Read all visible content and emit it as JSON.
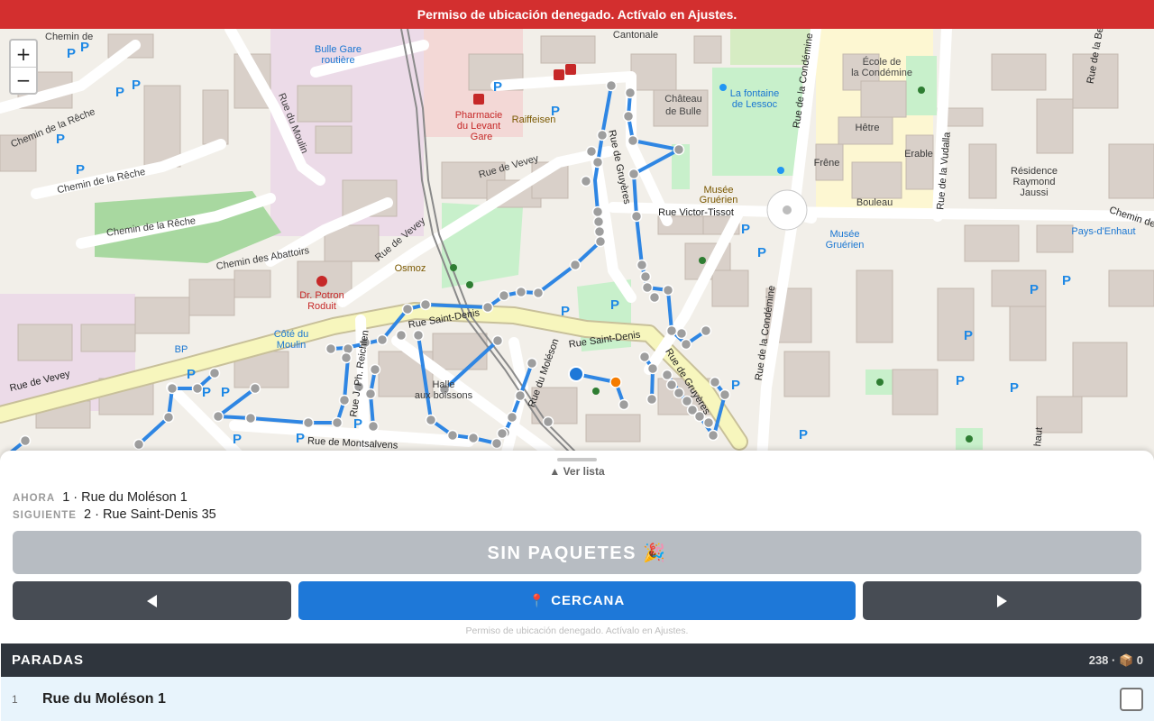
{
  "alert": {
    "text": "Permiso de ubicación denegado. Actívalo en Ajustes."
  },
  "map": {
    "zoom_in": "+",
    "zoom_out": "−",
    "labels": [
      {
        "text": "Chemin de",
        "dn": "map-label-chemin-de"
      },
      {
        "text": "Cantonale",
        "dn": "map-label-cantonale"
      },
      {
        "text": "Bulle Gare",
        "dn": "map-label-bulle-gare"
      },
      {
        "text": "routière",
        "dn": "map-label-routiere"
      },
      {
        "text": "Château",
        "dn": "map-label-chateau"
      },
      {
        "text": "de Bulle",
        "dn": "map-label-de-bulle"
      },
      {
        "text": "La fontaine",
        "dn": "map-label-fontaine"
      },
      {
        "text": "de Lessoc",
        "dn": "map-label-lessoc"
      },
      {
        "text": "École de",
        "dn": "map-label-ecole"
      },
      {
        "text": "la Condémine",
        "dn": "map-label-la-condemine"
      },
      {
        "text": "Hêtre",
        "dn": "map-label-hetre"
      },
      {
        "text": "Frêne",
        "dn": "map-label-frene"
      },
      {
        "text": "Erable",
        "dn": "map-label-erable"
      },
      {
        "text": "Bouleau",
        "dn": "map-label-bouleau"
      },
      {
        "text": "Résidence",
        "dn": "map-label-residence"
      },
      {
        "text": "Raymond",
        "dn": "map-label-raymond"
      },
      {
        "text": "Jaussi",
        "dn": "map-label-jaussi"
      },
      {
        "text": "Pharmacie",
        "dn": "map-label-pharmacie"
      },
      {
        "text": "du Levant",
        "dn": "map-label-du-levant"
      },
      {
        "text": "Gare",
        "dn": "map-label-gare"
      },
      {
        "text": "Raiffeisen",
        "dn": "map-label-raiffeisen"
      },
      {
        "text": "Rue de Vevey",
        "dn": "map-label-rue-vevey-north"
      },
      {
        "text": "Musée",
        "dn": "map-label-musee"
      },
      {
        "text": "Gruérien",
        "dn": "map-label-gruerien"
      },
      {
        "text": "Rue Victor-Tissot",
        "dn": "map-label-victor-tissot"
      },
      {
        "text": "Musée",
        "dn": "map-label-musee-2"
      },
      {
        "text": "Gruérien",
        "dn": "map-label-gruerien-2"
      },
      {
        "text": "Pays-d'Enhaut",
        "dn": "map-label-pays-enhaut"
      },
      {
        "text": "Chemin de la Rêche",
        "dn": "map-label-reche-1"
      },
      {
        "text": "Chemin de la Rêche",
        "dn": "map-label-reche-2"
      },
      {
        "text": "Chemin de la Rêche",
        "dn": "map-label-reche-3"
      },
      {
        "text": "Chemin des Abattoirs",
        "dn": "map-label-abattoirs"
      },
      {
        "text": "Rue du Moulin",
        "dn": "map-label-moulin"
      },
      {
        "text": "Rue de Vevey",
        "dn": "map-label-rue-vevey-mid"
      },
      {
        "text": "Osmoz",
        "dn": "map-label-osmoz"
      },
      {
        "text": "Dr. Potron",
        "dn": "map-label-dr-potron"
      },
      {
        "text": "Roduit",
        "dn": "map-label-roduit"
      },
      {
        "text": "Côté du",
        "dn": "map-label-cote-du"
      },
      {
        "text": "Moulin",
        "dn": "map-label-moulin-2"
      },
      {
        "text": "BP",
        "dn": "map-label-bp"
      },
      {
        "text": "Rue Saint-Denis",
        "dn": "map-label-saint-denis-1"
      },
      {
        "text": "Rue Saint-Denis",
        "dn": "map-label-saint-denis-2"
      },
      {
        "text": "Rue du Moléson",
        "dn": "map-label-moleson"
      },
      {
        "text": "Rue de Gruyères",
        "dn": "map-label-gruyeres-south"
      },
      {
        "text": "Rue de Gruyères",
        "dn": "map-label-gruyeres-north"
      },
      {
        "text": "Rue de la Condémine",
        "dn": "map-label-condemine-south"
      },
      {
        "text": "Rue de la Condémine",
        "dn": "map-label-condemine-north"
      },
      {
        "text": "Rue de la Vudalla",
        "dn": "map-label-vudalla"
      },
      {
        "text": "Rue de Vevey",
        "dn": "map-label-rue-vevey-west"
      },
      {
        "text": "Rue de Montsalvens",
        "dn": "map-label-montsalvens"
      },
      {
        "text": "Rue J. Ph. Reichlen",
        "dn": "map-label-reichlen"
      },
      {
        "text": "Halle",
        "dn": "map-label-halle"
      },
      {
        "text": "aux boissons",
        "dn": "map-label-aux-boissons"
      },
      {
        "text": "Chemin de",
        "dn": "map-label-chemin-de-east"
      },
      {
        "text": "Rue de la Be",
        "dn": "map-label-rue-de-la-be"
      },
      {
        "text": "haut",
        "dn": "map-label-haut"
      }
    ]
  },
  "sheet": {
    "ver_lista": "▲ Ver lista",
    "now_tag": "AHORA",
    "now_text": "1 · Rue du Moléson 1",
    "next_tag": "SIGUIENTE",
    "next_text": "2 · Rue Saint-Denis 35",
    "status_button": "SIN PAQUETES 🎉",
    "nearby_button": "CERCANA",
    "nearby_icon": "📍",
    "hint": "Permiso de ubicación denegado. Actívalo en Ajustes.",
    "list_title": "PARADAS",
    "list_count": "238 · 📦 0",
    "first_row": {
      "index": "1",
      "label": "Rue du Moléson 1"
    }
  },
  "colors": {
    "alert": "#d32f2f",
    "route": "#1e78d8",
    "stop": "#9e9e9e",
    "current": "#1e78d8",
    "next": "#f57c00",
    "dark_button": "#474c54",
    "list_header": "#2f353d"
  }
}
